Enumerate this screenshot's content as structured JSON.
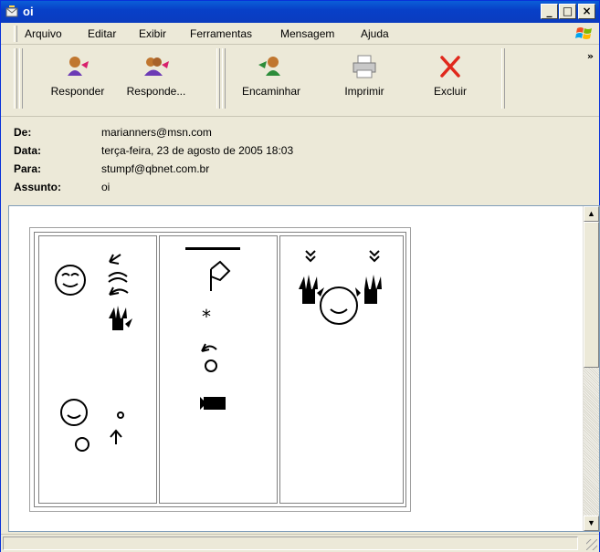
{
  "window": {
    "title": "oi"
  },
  "menu": {
    "items": [
      "Arquivo",
      "Editar",
      "Exibir",
      "Ferramentas",
      "Mensagem",
      "Ajuda"
    ]
  },
  "toolbar": {
    "reply_label": "Responder",
    "reply_all_label": "Responde...",
    "forward_label": "Encaminhar",
    "print_label": "Imprimir",
    "delete_label": "Excluir",
    "more_label": "»"
  },
  "headers": {
    "from_label": "De:",
    "from_value": "marianners@msn.com",
    "date_label": "Data:",
    "date_value": "terça-feira, 23 de agosto de 2005 18:03",
    "to_label": "Para:",
    "to_value": "stumpf@qbnet.com.br",
    "subject_label": "Assunto:",
    "subject_value": "oi"
  },
  "colors": {
    "title_bar": "#0a5fd8",
    "delete_red": "#e0281c",
    "body_bg": "#ffffff"
  },
  "icons": [
    "window-icon",
    "minimize-icon",
    "maximize-icon",
    "close-icon",
    "windows-logo-icon",
    "reply-icon",
    "reply-all-icon",
    "forward-icon",
    "print-icon",
    "delete-icon"
  ]
}
